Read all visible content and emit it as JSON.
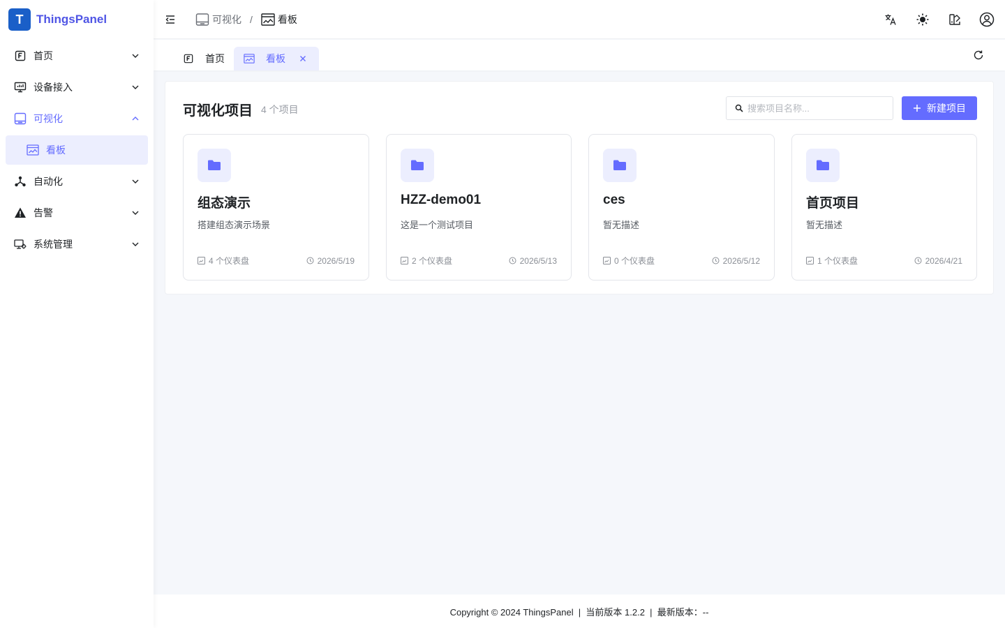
{
  "brand": {
    "name": "ThingsPanel",
    "logo_letter": "T"
  },
  "sidebar": {
    "items": [
      {
        "label": "首页",
        "icon": "home-icon",
        "expanded": false
      },
      {
        "label": "设备接入",
        "icon": "monitor-icon",
        "expanded": false
      },
      {
        "label": "可视化",
        "icon": "screen-icon",
        "expanded": true
      },
      {
        "label": "看板",
        "icon": "dashboard-icon",
        "selected": true
      },
      {
        "label": "自动化",
        "icon": "network-icon",
        "expanded": false
      },
      {
        "label": "告警",
        "icon": "warning-icon",
        "expanded": false
      },
      {
        "label": "系统管理",
        "icon": "system-settings-icon",
        "expanded": false
      }
    ]
  },
  "breadcrumb": [
    {
      "label": "可视化",
      "icon": "screen-icon"
    },
    {
      "label": "看板",
      "icon": "dashboard-icon"
    }
  ],
  "breadcrumb_separator": "/",
  "tabs": [
    {
      "label": "首页",
      "icon": "home-icon",
      "active": false
    },
    {
      "label": "看板",
      "icon": "dashboard-icon",
      "active": true,
      "closable": true
    }
  ],
  "main": {
    "title": "可视化项目",
    "count": "4 个项目",
    "search_placeholder": "搜索项目名称...",
    "new_button": "新建项目",
    "projects": [
      {
        "name": "组态演示",
        "description": "搭建组态演示场景",
        "dashboards": "4 个仪表盘",
        "date": "2026/5/19"
      },
      {
        "name": "HZZ-demo01",
        "description": "这是一个测试项目",
        "dashboards": "2 个仪表盘",
        "date": "2026/5/13"
      },
      {
        "name": "ces",
        "description": "暂无描述",
        "dashboards": "0 个仪表盘",
        "date": "2026/5/12"
      },
      {
        "name": "首页项目",
        "description": "暂无描述",
        "dashboards": "1 个仪表盘",
        "date": "2026/4/21"
      }
    ]
  },
  "footer": {
    "text": "Copyright © 2024 ThingsPanel  |  当前版本 1.2.2  |  最新版本：--"
  },
  "colors": {
    "accent": "#646cff",
    "accent_light": "#eceefe",
    "brand": "#4f55e5",
    "logo_bg": "#1a5fc8"
  }
}
